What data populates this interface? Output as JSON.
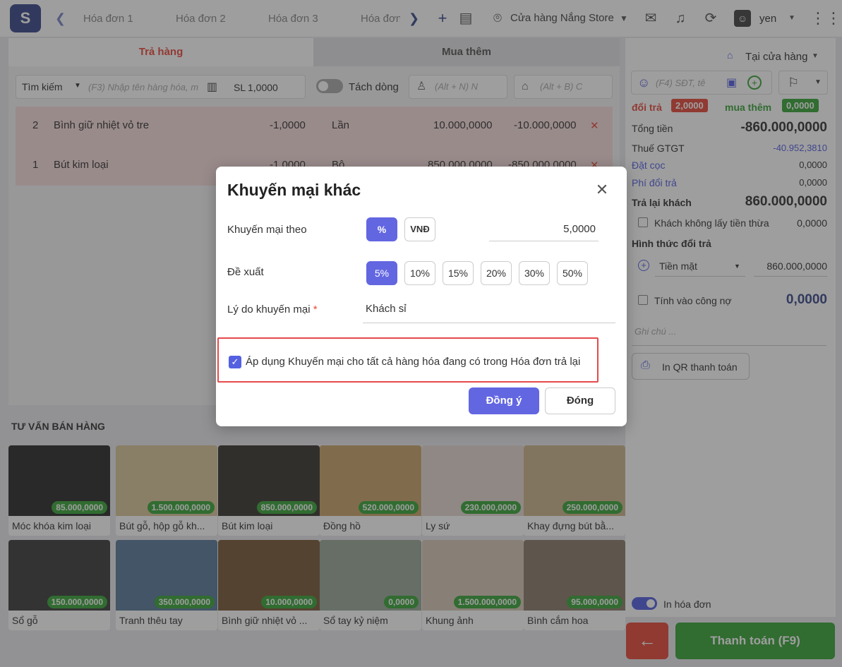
{
  "topbar": {
    "tabs": [
      "Hóa đơn 1",
      "Hóa đơn 2",
      "Hóa đơn 3",
      "Hóa đơn"
    ],
    "store": "Cửa hàng Nắng Store",
    "user": "yen"
  },
  "left": {
    "tab_return": "Trả hàng",
    "tab_buy": "Mua thêm",
    "search_mode": "Tìm kiếm",
    "search_placeholder": "(F3) Nhập tên hàng hóa, m",
    "qty_label": "SL",
    "qty_value": "1,0000",
    "split_label": "Tách dòng",
    "customer_placeholder": "(Alt + N) N",
    "price_placeholder": "(Alt + B) C",
    "rows": [
      {
        "no": "2",
        "name": "Bình giữ nhiệt vỏ tre",
        "qty": "-1,0000",
        "unit": "Lần",
        "price": "10.000,0000",
        "total": "-10.000,0000"
      },
      {
        "no": "1",
        "name": "Bút kim loại",
        "qty": "-1,0000",
        "unit": "Bộ",
        "price": "850.000,0000",
        "total": "-850.000,0000"
      }
    ]
  },
  "suggest": {
    "title": "TƯ VẤN BÁN HÀNG",
    "products": [
      {
        "name": "Móc khóa kim loại",
        "price": "85.000,0000"
      },
      {
        "name": "Bút gỗ, hộp gỗ kh...",
        "price": "1.500.000,0000"
      },
      {
        "name": "Bút kim loại",
        "price": "850.000,0000"
      },
      {
        "name": "Đồng hồ",
        "price": "520.000,0000"
      },
      {
        "name": "Ly sứ",
        "price": "230.000,0000"
      },
      {
        "name": "Khay đựng bút bằ...",
        "price": "250.000,0000"
      },
      {
        "name": "Sổ gỗ",
        "price": "150.000,0000"
      },
      {
        "name": "Tranh thêu tay",
        "price": "350.000,0000"
      },
      {
        "name": "Bình giữ nhiệt vỏ ...",
        "price": "10.000,0000"
      },
      {
        "name": "Sổ tay kỷ niệm",
        "price": "0,0000"
      },
      {
        "name": "Khung ảnh",
        "price": "1.500.000,0000"
      },
      {
        "name": "Bình cắm hoa",
        "price": "95.000,0000"
      }
    ]
  },
  "right": {
    "store_mode": "Tại cửa hàng",
    "phone_placeholder": "(F4) SĐT, tê",
    "return_label": "đổi trả",
    "return_badge": "2,0000",
    "buy_label": "mua thêm",
    "buy_badge": "0,0000",
    "total_label": "Tổng tiền",
    "total_value": "-860.000,0000",
    "vat_label": "Thuế GTGT",
    "vat_value": "-40.952,3810",
    "deposit_label": "Đặt cọc",
    "deposit_value": "0,0000",
    "fee_label": "Phí đổi trả",
    "fee_value": "0,0000",
    "refund_label": "Trả lại khách",
    "refund_value": "860.000,0000",
    "nochange_label": "Khách không lấy tiền thừa",
    "nochange_value": "0,0000",
    "method_title": "Hình thức đổi trả",
    "method": "Tiền mặt",
    "method_value": "860.000,0000",
    "debt_label": "Tính vào công nợ",
    "debt_value": "0,0000",
    "note_placeholder": "Ghi chú ...",
    "qr_button": "In QR thanh toán",
    "print_label": "In hóa đơn",
    "pay_button": "Thanh toán (F9)"
  },
  "modal": {
    "title": "Khuyến mại khác",
    "by_label": "Khuyến mại theo",
    "unit_percent": "%",
    "unit_vnd": "VNĐ",
    "value": "5,0000",
    "suggest_label": "Đề xuất",
    "suggestions": [
      "5%",
      "10%",
      "15%",
      "20%",
      "30%",
      "50%"
    ],
    "reason_label": "Lý do khuyến mại",
    "reason_required": "*",
    "reason_value": "Khách sỉ",
    "apply_all_label": "Áp dụng Khuyến mại cho tất cả hàng hóa đang có trong Hóa đơn trả lại",
    "ok_button": "Đồng ý",
    "close_button": "Đóng"
  },
  "colors": {
    "accent": "#6366e1",
    "danger": "#e64a3b",
    "success": "#3aa53a",
    "brand": "#3a4a8a"
  }
}
